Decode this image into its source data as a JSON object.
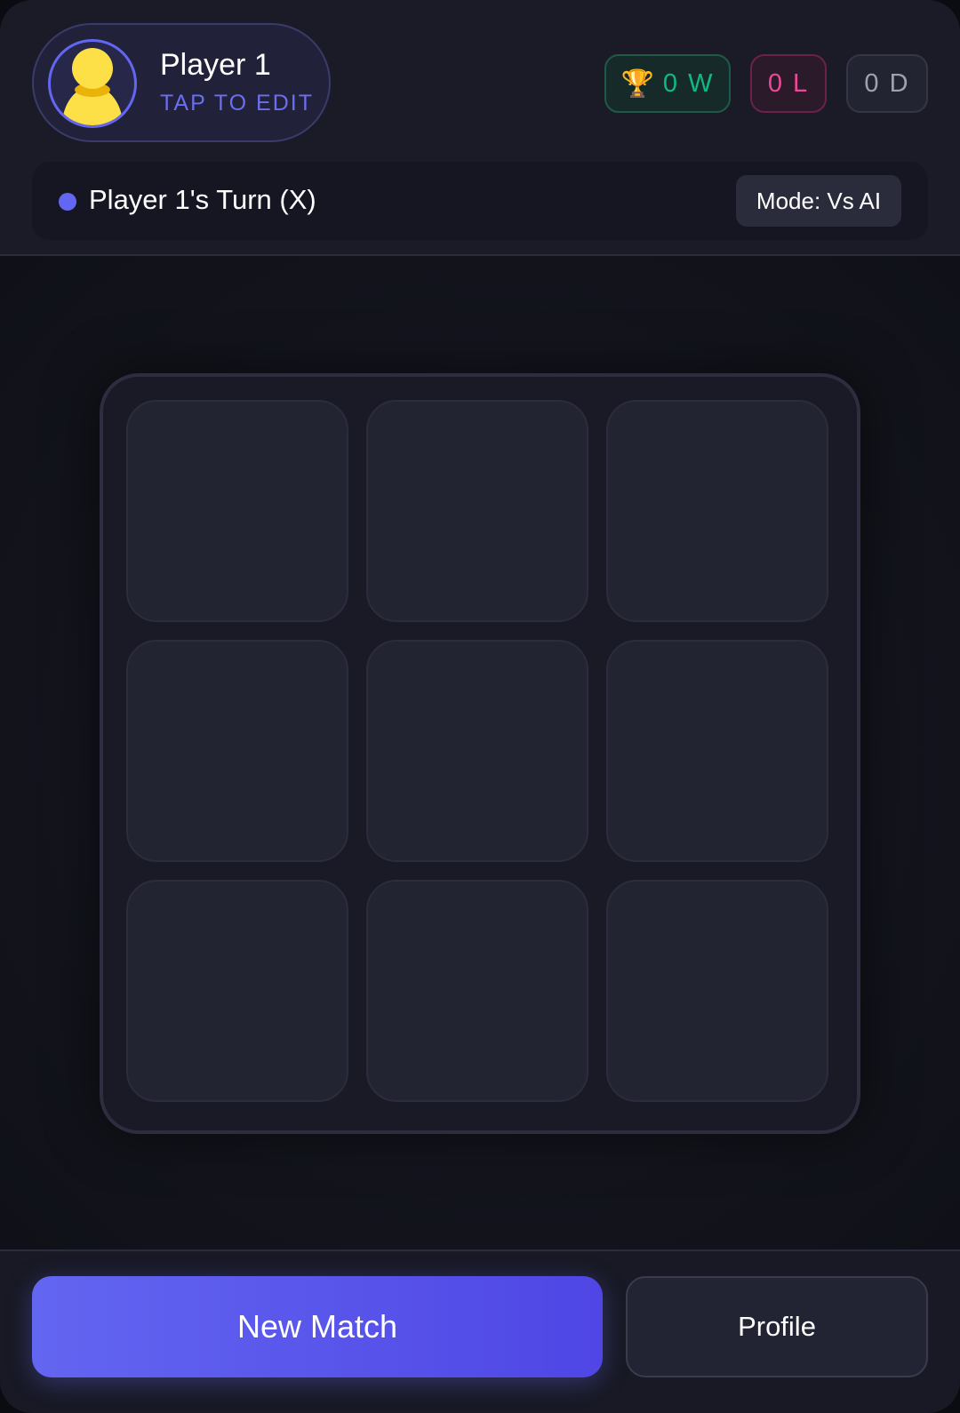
{
  "player": {
    "name": "Player 1",
    "edit_hint": "TAP TO EDIT",
    "avatar_icon": "person-icon"
  },
  "stats": {
    "wins_icon": "🏆",
    "wins": "0 W",
    "losses": "0 L",
    "draws": "0 D"
  },
  "status": {
    "turn_text": "Player 1's Turn (X)",
    "mode_label": "Mode: Vs AI"
  },
  "board": {
    "cells": [
      "",
      "",
      "",
      "",
      "",
      "",
      "",
      "",
      ""
    ]
  },
  "actions": {
    "new_match_label": "New Match",
    "profile_label": "Profile"
  },
  "colors": {
    "accent": "#6366f1",
    "win": "#10b981",
    "loss": "#ec4899",
    "draw": "#9ca3af",
    "avatar": "#fde047"
  }
}
